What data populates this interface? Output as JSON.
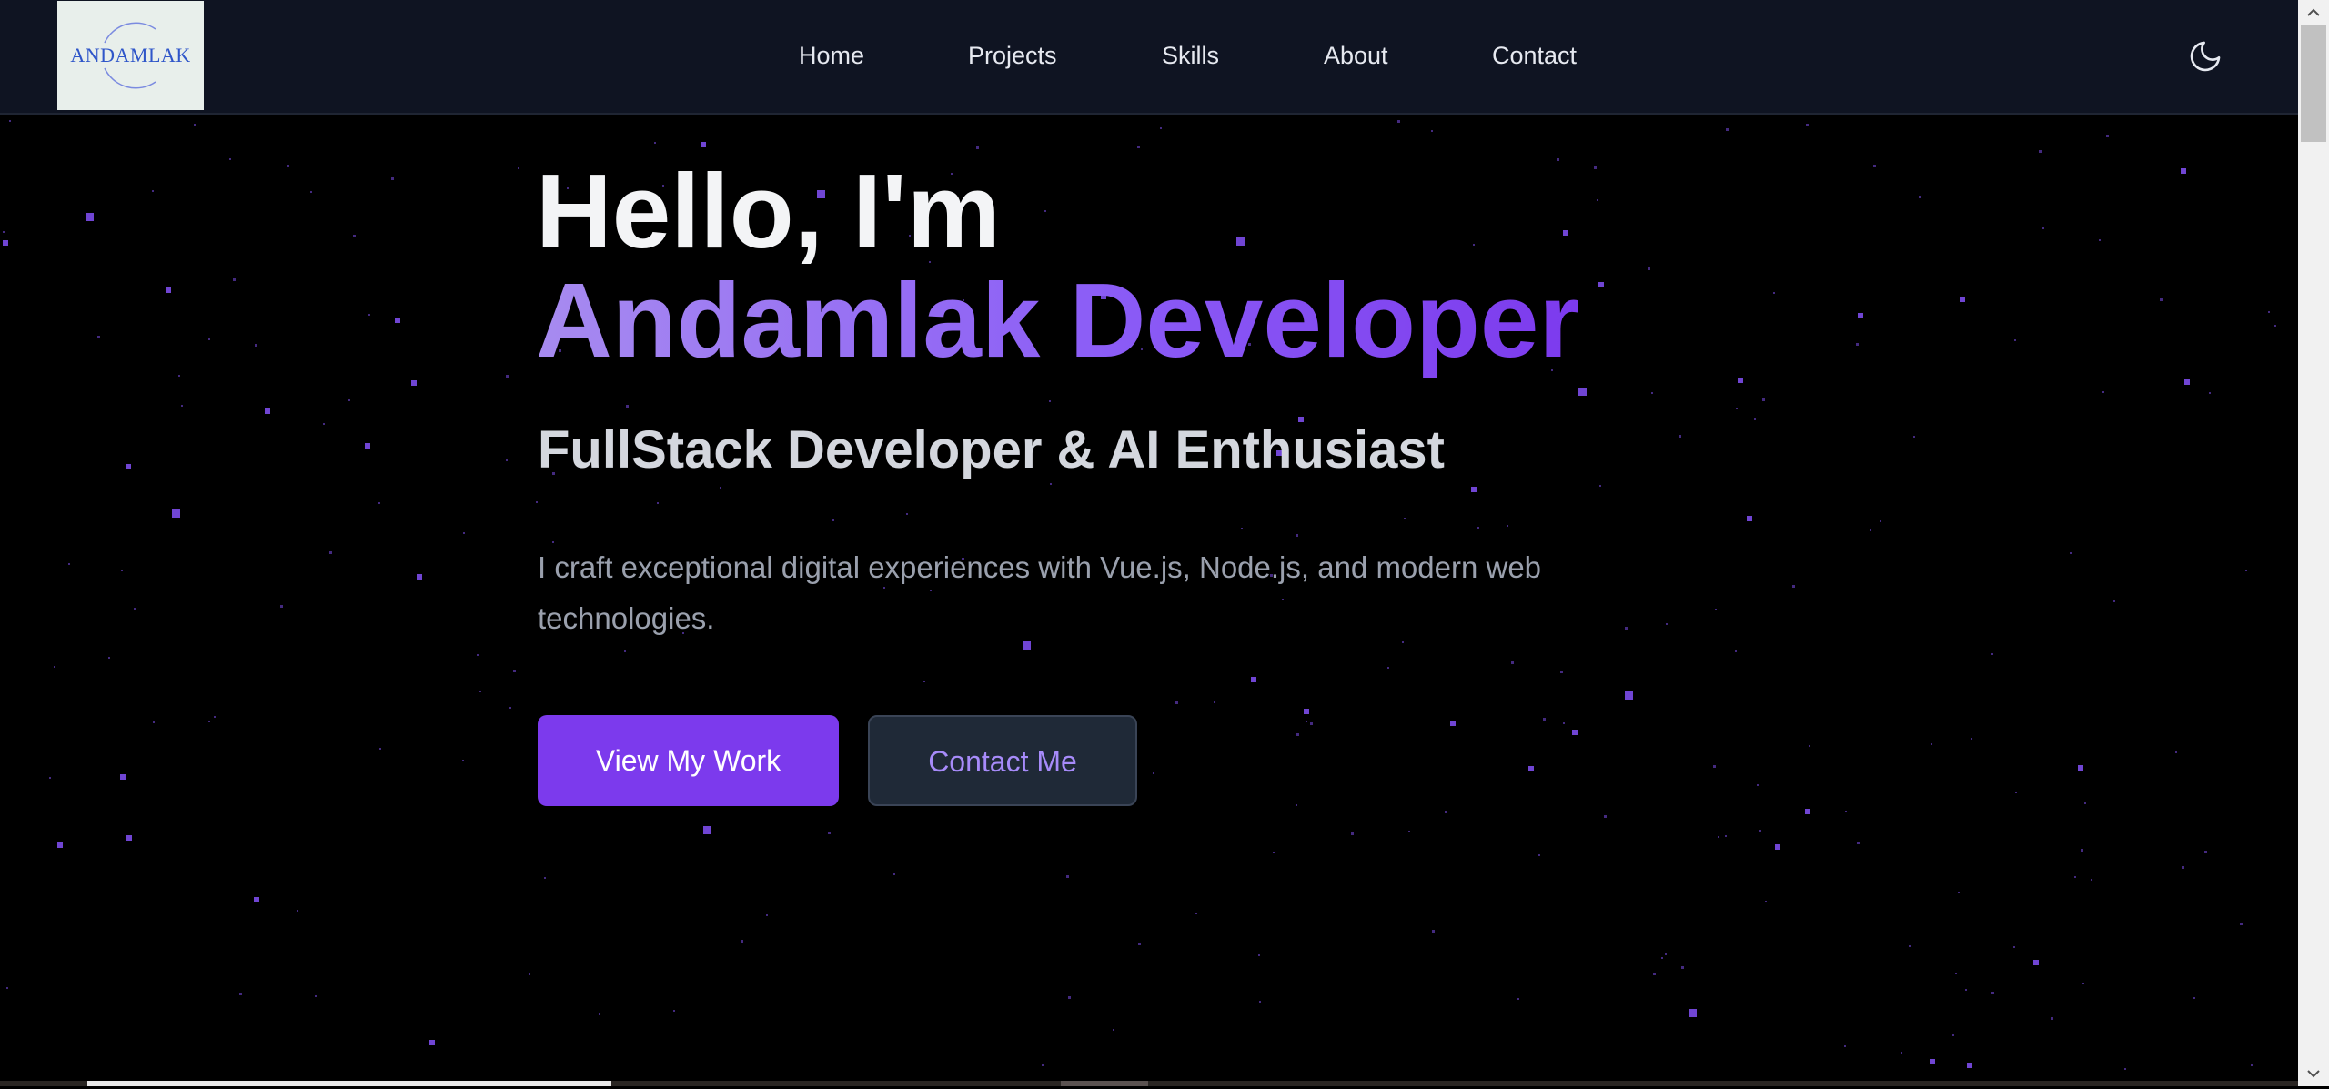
{
  "header": {
    "logo_text": "ANDAMLAK",
    "nav": [
      "Home",
      "Projects",
      "Skills",
      "About",
      "Contact"
    ],
    "theme_icon": "moon-icon"
  },
  "hero": {
    "greeting": "Hello, I'm",
    "name": "Andamlak Developer",
    "role": "FullStack Developer & AI Enthusiast",
    "description": "I craft exceptional digital experiences with Vue.js, Node.js, and modern web technologies.",
    "primary_button": "View My Work",
    "secondary_button": "Contact Me"
  },
  "colors": {
    "accent": "#7c3aed",
    "accent_light": "#a78bfa",
    "background": "#000000",
    "header_bg": "#0f1422",
    "star": "#7c4dea"
  }
}
